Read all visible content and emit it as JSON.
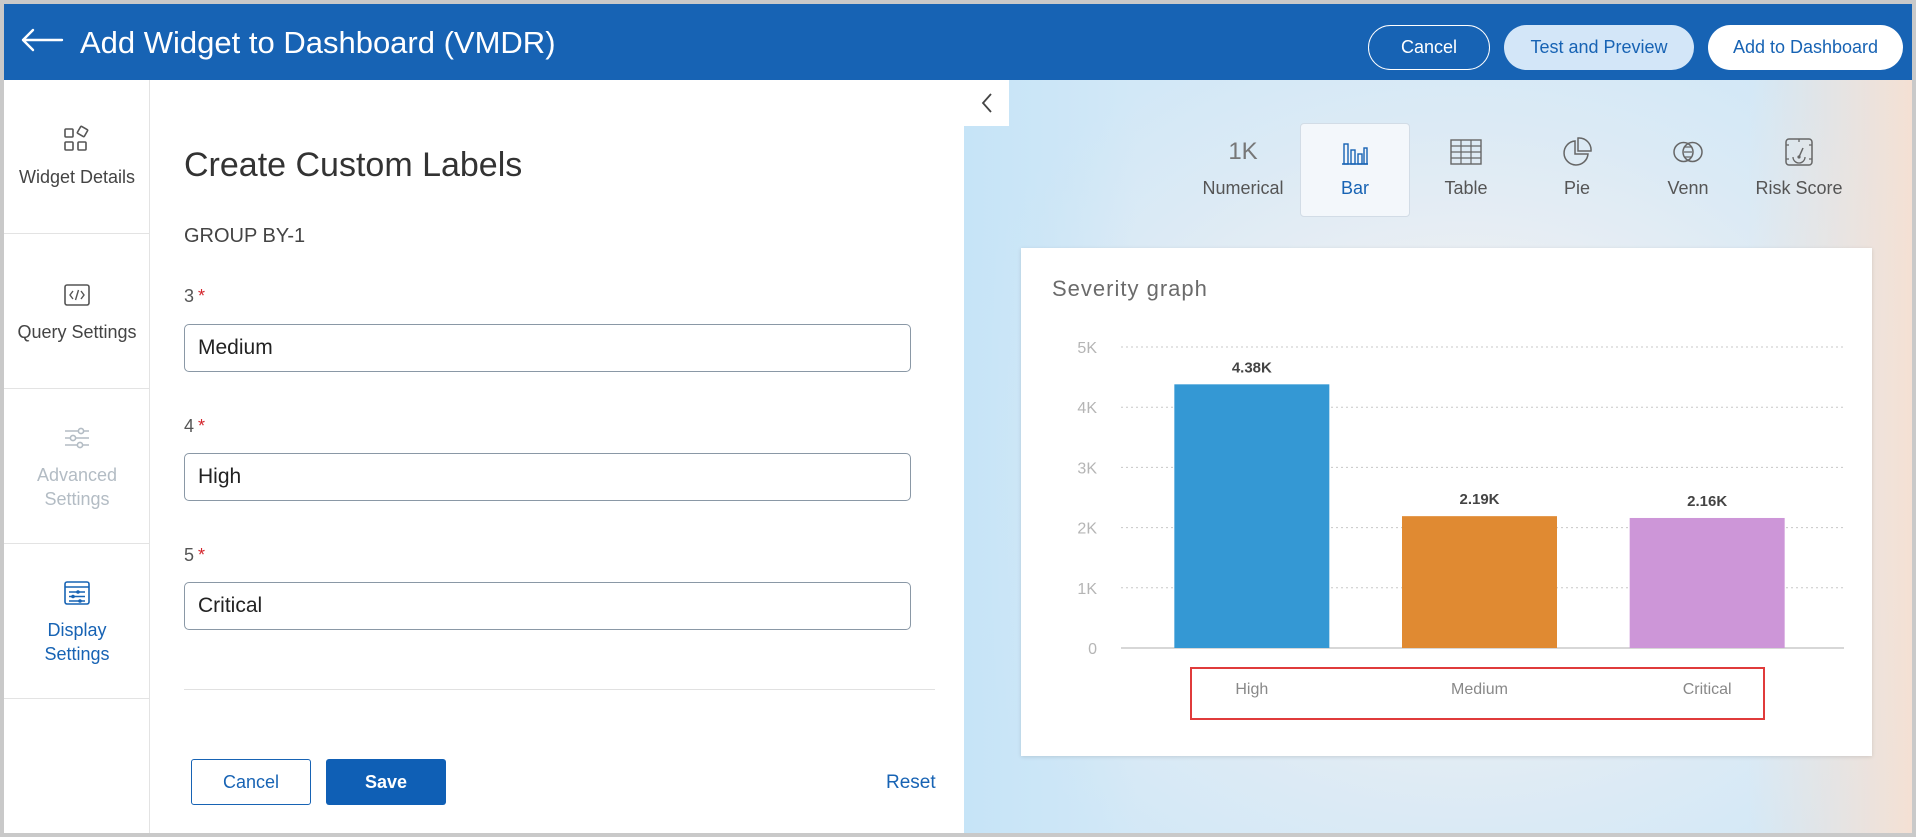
{
  "header": {
    "title": "Add Widget to Dashboard (VMDR)",
    "cancel_label": "Cancel",
    "test_preview_label": "Test and Preview",
    "add_to_dashboard_label": "Add to Dashboard"
  },
  "sidebar": {
    "items": [
      {
        "label": "Widget Details",
        "icon": "widget-icon",
        "state": "normal"
      },
      {
        "label": "Query Settings",
        "icon": "code-icon",
        "state": "normal"
      },
      {
        "label": "Advanced Settings",
        "icon": "sliders-icon",
        "state": "disabled"
      },
      {
        "label": "Display Settings",
        "icon": "display-settings-icon",
        "state": "active"
      }
    ]
  },
  "form": {
    "title": "Create Custom Labels",
    "group_label": "GROUP BY-1",
    "required_mark": "*",
    "fields": [
      {
        "label": "3",
        "value": "Medium"
      },
      {
        "label": "4",
        "value": "High"
      },
      {
        "label": "5",
        "value": "Critical"
      }
    ],
    "cancel_label": "Cancel",
    "save_label": "Save",
    "reset_label": "Reset"
  },
  "preview": {
    "chart_types": [
      {
        "label": "Numerical",
        "icon_text": "1K",
        "active": false
      },
      {
        "label": "Bar",
        "icon": "bar-chart-icon",
        "active": true
      },
      {
        "label": "Table",
        "icon": "table-icon",
        "active": false
      },
      {
        "label": "Pie",
        "icon": "pie-chart-icon",
        "active": false
      },
      {
        "label": "Venn",
        "icon": "venn-icon",
        "active": false
      },
      {
        "label": "Risk Score",
        "icon": "risk-score-icon",
        "active": false
      }
    ]
  },
  "colors": {
    "header_bg": "#1763b4",
    "primary": "#1763b4",
    "required": "#d4252c",
    "highlight_box": "#e03b3b"
  },
  "chart_data": {
    "type": "bar",
    "title": "Severity graph",
    "categories": [
      "High",
      "Medium",
      "Critical"
    ],
    "values": [
      4380,
      2190,
      2160
    ],
    "data_labels": [
      "4.38K",
      "2.19K",
      "2.16K"
    ],
    "colors": [
      "#3498d4",
      "#e08a32",
      "#cd96d8"
    ],
    "yticks": [
      0,
      1000,
      2000,
      3000,
      4000,
      5000
    ],
    "ytick_labels": [
      "0",
      "1K",
      "2K",
      "3K",
      "4K",
      "5K"
    ],
    "ylim": [
      0,
      5000
    ],
    "xlabel": "",
    "ylabel": "",
    "grid": true
  }
}
